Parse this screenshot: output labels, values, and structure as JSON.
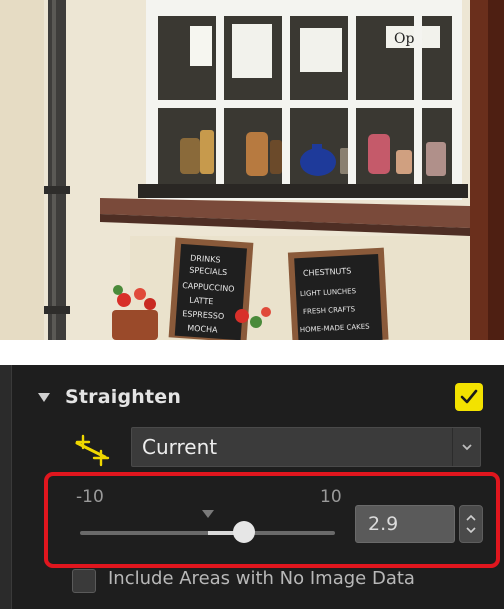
{
  "photo": {
    "window_sign": "Ope",
    "board_left_text": [
      "DRINKS",
      "SPECIALS",
      "CAPPUCCINO",
      "LATTE",
      "ESPRESSO",
      "MOCHA"
    ],
    "board_right_text": [
      "CHESTNUTS",
      "LIGHT LUNCHES",
      "FRESH CRAFTS",
      "HOME-MADE CAKES"
    ]
  },
  "straighten": {
    "title": "Straighten",
    "enabled": true,
    "mode_icon": "straighten-mode-icon",
    "mode": "Current",
    "range_min": "-10",
    "range_max": "10",
    "value": "2.9",
    "include_label": "Include Areas with No Image Data",
    "include_checked": false
  },
  "colors": {
    "panel_bg": "#1e1e1e",
    "accent_check": "#f3e200",
    "highlight": "#e0161e",
    "icon_yellow": "#f0d800"
  }
}
